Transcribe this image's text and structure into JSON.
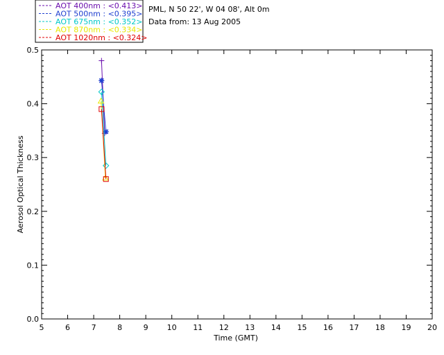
{
  "info": {
    "site": "PML, N 50 22', W 04 08', Alt 0m",
    "date": "Data from: 13 Aug 2005"
  },
  "chart_data": {
    "type": "line",
    "xlabel": "Time (GMT)",
    "ylabel": "Aerosol Optical Thickness",
    "xlim": [
      5,
      20
    ],
    "ylim": [
      0.0,
      0.5
    ],
    "xticks": [
      "5",
      "6",
      "7",
      "8",
      "9",
      "10",
      "11",
      "12",
      "13",
      "14",
      "15",
      "16",
      "17",
      "18",
      "19",
      "20"
    ],
    "yticks": [
      "0.0",
      "0.1",
      "0.2",
      "0.3",
      "0.4",
      "0.5"
    ],
    "legend_position": "top-left",
    "series": [
      {
        "name": "AOT  400nm : <0.413>",
        "color": "#6a0dad",
        "marker": "plus",
        "points": [
          [
            7.3,
            0.48
          ],
          [
            7.42,
            0.345
          ]
        ]
      },
      {
        "name": "AOT  500nm : <0.395>",
        "color": "#1f3fd0",
        "marker": "star",
        "points": [
          [
            7.3,
            0.443
          ],
          [
            7.47,
            0.348
          ]
        ]
      },
      {
        "name": "AOT  675nm : <0.352>",
        "color": "#00c8c8",
        "marker": "diamond",
        "points": [
          [
            7.3,
            0.422
          ],
          [
            7.47,
            0.285
          ]
        ]
      },
      {
        "name": "AOT  870nm : <0.334>",
        "color": "#e8e800",
        "marker": "triangle",
        "points": [
          [
            7.28,
            0.405
          ],
          [
            7.45,
            0.262
          ]
        ]
      },
      {
        "name": "AOT 1020nm : <0.324>",
        "color": "#e00000",
        "marker": "square",
        "points": [
          [
            7.3,
            0.39
          ],
          [
            7.47,
            0.26
          ]
        ]
      }
    ]
  }
}
